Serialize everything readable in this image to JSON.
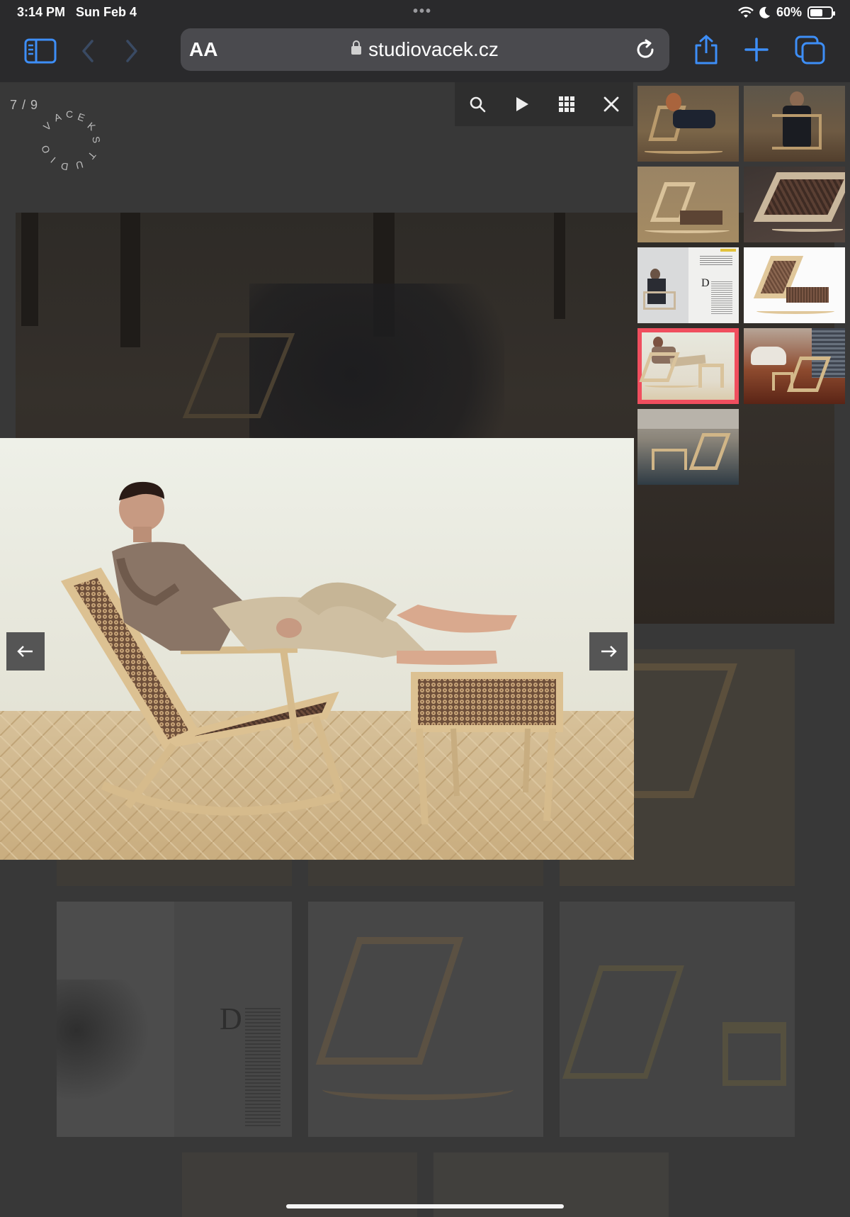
{
  "status": {
    "time": "3:14 PM",
    "date": "Sun Feb 4",
    "battery": "60%",
    "battery_level": 0.6
  },
  "browser": {
    "aa_label": "AA",
    "url": "studiovacek.cz",
    "icons": [
      "sidebar-icon",
      "back-icon",
      "forward-icon",
      "lock-icon",
      "reload-icon",
      "share-icon",
      "new-tab-icon",
      "tabs-icon"
    ]
  },
  "page": {
    "counter": "7 / 9",
    "logo_text": "VACEK STUDIO"
  },
  "lightbox": {
    "controls": [
      "search-icon",
      "play-icon",
      "grid-icon",
      "close-icon"
    ],
    "thumbnails": [
      {
        "name": "thumb-forest-man-1"
      },
      {
        "name": "thumb-forest-man-2"
      },
      {
        "name": "thumb-chair-grass"
      },
      {
        "name": "thumb-chair-detail"
      },
      {
        "name": "thumb-magazine"
      },
      {
        "name": "thumb-chair-white"
      },
      {
        "name": "thumb-man-footrest"
      },
      {
        "name": "thumb-showroom"
      },
      {
        "name": "thumb-exhibition"
      }
    ],
    "active_index": 6,
    "prev_icon": "arrow-left-icon",
    "next_icon": "arrow-right-icon"
  },
  "colors": {
    "accent": "#3d8ef7",
    "active_thumb": "#f04e5e",
    "toolbar": "#2a2a2c",
    "backdrop": "#383838"
  }
}
